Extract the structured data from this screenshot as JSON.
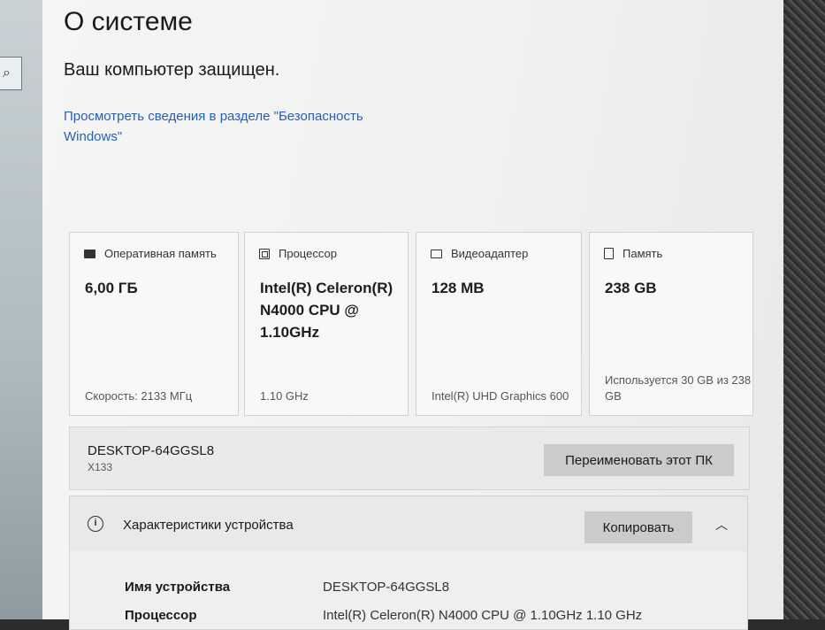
{
  "sidebar": {
    "search_icon": "search-icon"
  },
  "page": {
    "title": "О системе",
    "protection_status": "Ваш компьютер защищен.",
    "security_link": "Просмотреть сведения в разделе \"Безопасность Windows\""
  },
  "cards": [
    {
      "icon": "memory-icon",
      "label": "Оперативная память",
      "value": "6,00 ГБ",
      "sub": "Скорость: 2133 МГц"
    },
    {
      "icon": "processor-icon",
      "label": "Процессор",
      "value": "Intel(R) Celeron(R) N4000 CPU @ 1.10GHz",
      "sub": "1.10 GHz"
    },
    {
      "icon": "display-adapter-icon",
      "label": "Видеоадаптер",
      "value": "128 MB",
      "sub": "Intel(R) UHD Graphics 600"
    },
    {
      "icon": "storage-icon",
      "label": "Память",
      "value": "238 GB",
      "sub": "Используется 30 GB из 238 GB"
    }
  ],
  "computer": {
    "name": "DESKTOP-64GGSL8",
    "model": "X133",
    "rename_button": "Переименовать этот ПК"
  },
  "device_specs": {
    "title": "Характеристики устройства",
    "copy_button": "Копировать",
    "rows": [
      {
        "label": "Имя устройства",
        "value": "DESKTOP-64GGSL8"
      },
      {
        "label": "Процессор",
        "value": "Intel(R) Celeron(R) N4000 CPU @ 1.10GHz   1.10 GHz"
      }
    ]
  }
}
